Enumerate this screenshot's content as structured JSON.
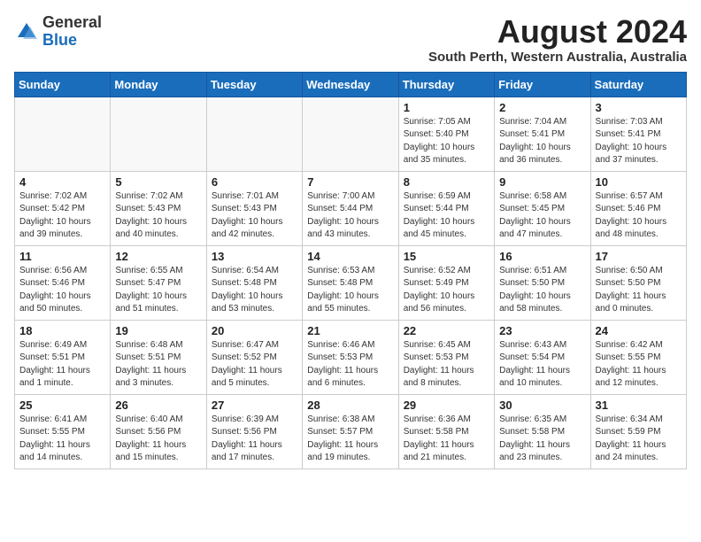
{
  "header": {
    "logo_line1": "General",
    "logo_line2": "Blue",
    "title": "August 2024",
    "subtitle": "South Perth, Western Australia, Australia"
  },
  "days_of_week": [
    "Sunday",
    "Monday",
    "Tuesday",
    "Wednesday",
    "Thursday",
    "Friday",
    "Saturday"
  ],
  "weeks": [
    [
      {
        "day": "",
        "info": ""
      },
      {
        "day": "",
        "info": ""
      },
      {
        "day": "",
        "info": ""
      },
      {
        "day": "",
        "info": ""
      },
      {
        "day": "1",
        "info": "Sunrise: 7:05 AM\nSunset: 5:40 PM\nDaylight: 10 hours\nand 35 minutes."
      },
      {
        "day": "2",
        "info": "Sunrise: 7:04 AM\nSunset: 5:41 PM\nDaylight: 10 hours\nand 36 minutes."
      },
      {
        "day": "3",
        "info": "Sunrise: 7:03 AM\nSunset: 5:41 PM\nDaylight: 10 hours\nand 37 minutes."
      }
    ],
    [
      {
        "day": "4",
        "info": "Sunrise: 7:02 AM\nSunset: 5:42 PM\nDaylight: 10 hours\nand 39 minutes."
      },
      {
        "day": "5",
        "info": "Sunrise: 7:02 AM\nSunset: 5:43 PM\nDaylight: 10 hours\nand 40 minutes."
      },
      {
        "day": "6",
        "info": "Sunrise: 7:01 AM\nSunset: 5:43 PM\nDaylight: 10 hours\nand 42 minutes."
      },
      {
        "day": "7",
        "info": "Sunrise: 7:00 AM\nSunset: 5:44 PM\nDaylight: 10 hours\nand 43 minutes."
      },
      {
        "day": "8",
        "info": "Sunrise: 6:59 AM\nSunset: 5:44 PM\nDaylight: 10 hours\nand 45 minutes."
      },
      {
        "day": "9",
        "info": "Sunrise: 6:58 AM\nSunset: 5:45 PM\nDaylight: 10 hours\nand 47 minutes."
      },
      {
        "day": "10",
        "info": "Sunrise: 6:57 AM\nSunset: 5:46 PM\nDaylight: 10 hours\nand 48 minutes."
      }
    ],
    [
      {
        "day": "11",
        "info": "Sunrise: 6:56 AM\nSunset: 5:46 PM\nDaylight: 10 hours\nand 50 minutes."
      },
      {
        "day": "12",
        "info": "Sunrise: 6:55 AM\nSunset: 5:47 PM\nDaylight: 10 hours\nand 51 minutes."
      },
      {
        "day": "13",
        "info": "Sunrise: 6:54 AM\nSunset: 5:48 PM\nDaylight: 10 hours\nand 53 minutes."
      },
      {
        "day": "14",
        "info": "Sunrise: 6:53 AM\nSunset: 5:48 PM\nDaylight: 10 hours\nand 55 minutes."
      },
      {
        "day": "15",
        "info": "Sunrise: 6:52 AM\nSunset: 5:49 PM\nDaylight: 10 hours\nand 56 minutes."
      },
      {
        "day": "16",
        "info": "Sunrise: 6:51 AM\nSunset: 5:50 PM\nDaylight: 10 hours\nand 58 minutes."
      },
      {
        "day": "17",
        "info": "Sunrise: 6:50 AM\nSunset: 5:50 PM\nDaylight: 11 hours\nand 0 minutes."
      }
    ],
    [
      {
        "day": "18",
        "info": "Sunrise: 6:49 AM\nSunset: 5:51 PM\nDaylight: 11 hours\nand 1 minute."
      },
      {
        "day": "19",
        "info": "Sunrise: 6:48 AM\nSunset: 5:51 PM\nDaylight: 11 hours\nand 3 minutes."
      },
      {
        "day": "20",
        "info": "Sunrise: 6:47 AM\nSunset: 5:52 PM\nDaylight: 11 hours\nand 5 minutes."
      },
      {
        "day": "21",
        "info": "Sunrise: 6:46 AM\nSunset: 5:53 PM\nDaylight: 11 hours\nand 6 minutes."
      },
      {
        "day": "22",
        "info": "Sunrise: 6:45 AM\nSunset: 5:53 PM\nDaylight: 11 hours\nand 8 minutes."
      },
      {
        "day": "23",
        "info": "Sunrise: 6:43 AM\nSunset: 5:54 PM\nDaylight: 11 hours\nand 10 minutes."
      },
      {
        "day": "24",
        "info": "Sunrise: 6:42 AM\nSunset: 5:55 PM\nDaylight: 11 hours\nand 12 minutes."
      }
    ],
    [
      {
        "day": "25",
        "info": "Sunrise: 6:41 AM\nSunset: 5:55 PM\nDaylight: 11 hours\nand 14 minutes."
      },
      {
        "day": "26",
        "info": "Sunrise: 6:40 AM\nSunset: 5:56 PM\nDaylight: 11 hours\nand 15 minutes."
      },
      {
        "day": "27",
        "info": "Sunrise: 6:39 AM\nSunset: 5:56 PM\nDaylight: 11 hours\nand 17 minutes."
      },
      {
        "day": "28",
        "info": "Sunrise: 6:38 AM\nSunset: 5:57 PM\nDaylight: 11 hours\nand 19 minutes."
      },
      {
        "day": "29",
        "info": "Sunrise: 6:36 AM\nSunset: 5:58 PM\nDaylight: 11 hours\nand 21 minutes."
      },
      {
        "day": "30",
        "info": "Sunrise: 6:35 AM\nSunset: 5:58 PM\nDaylight: 11 hours\nand 23 minutes."
      },
      {
        "day": "31",
        "info": "Sunrise: 6:34 AM\nSunset: 5:59 PM\nDaylight: 11 hours\nand 24 minutes."
      }
    ]
  ]
}
